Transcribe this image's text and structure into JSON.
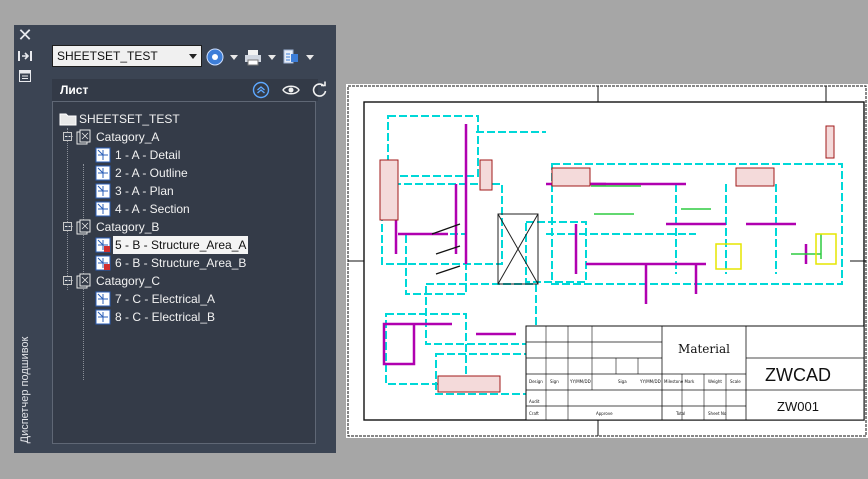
{
  "sheet_set_manager": {
    "vertical_title": "Диспетчер подшивок",
    "sheet_set_select": {
      "value": "SHEETSET_TEST"
    },
    "toolbar": {
      "icons": [
        "sheet-set-icon",
        "publish-icon",
        "model-view-icon"
      ]
    },
    "sheets_header": {
      "title": "Лист"
    },
    "tree": {
      "root": "SHEETSET_TEST",
      "categories": [
        {
          "label": "Catagory_A",
          "sheets": [
            "1 - A - Detail",
            "2 - A - Outline",
            "3 - A - Plan",
            "4 - A - Section"
          ]
        },
        {
          "label": "Catagory_B",
          "sheets": [
            "5 - B - Structure_Area_A",
            "6 - B - Structure_Area_B"
          ]
        },
        {
          "label": "Catagory_C",
          "sheets": [
            "7 - C - Electrical_A",
            "8 - C - Electrical_B"
          ]
        }
      ],
      "selected_sheet": "5 - B - Structure_Area_A"
    }
  },
  "drawing": {
    "title_block": {
      "material": "Material",
      "company": "ZWCAD",
      "drawing_no": "ZW001",
      "fields": [
        "Design",
        "Sign",
        "YY/MM/DD",
        "Siga",
        "YY/MM/DD",
        "Milestone Mark",
        "Weight",
        "Scale",
        "Audit",
        "Craft",
        "Approve",
        "Total",
        "Sheet No"
      ]
    }
  },
  "colors": {
    "panel": "#3b4453",
    "tree_bg": "#343b48",
    "canvas": "#a6a6a6",
    "cyan": "#00e0e0",
    "magenta": "#b000b0"
  }
}
